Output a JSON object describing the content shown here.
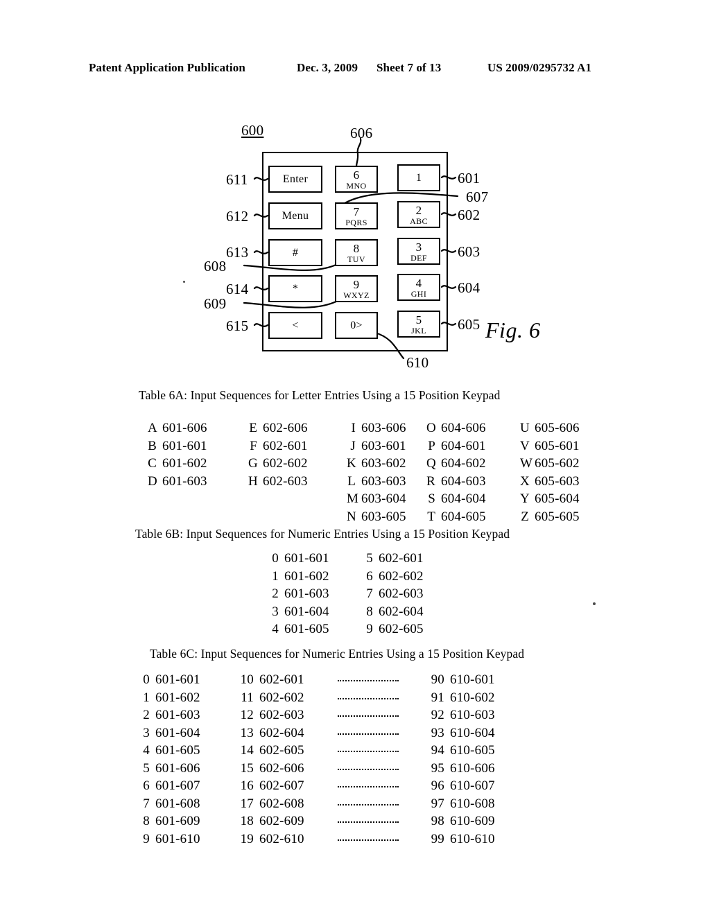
{
  "header": {
    "publication": "Patent Application Publication",
    "date": "Dec. 3, 2009",
    "sheet": "Sheet 7 of 13",
    "patent_number": "US 2009/0295732 A1"
  },
  "figure": {
    "caption": "Fig. 6",
    "device_ref": "600",
    "callouts": {
      "c600": "600",
      "c606": "606",
      "c607": "607",
      "c608": "608",
      "c609": "609",
      "c610": "610",
      "c601": "601",
      "c602": "602",
      "c603": "603",
      "c604": "604",
      "c605": "605",
      "c611": "611",
      "c612": "612",
      "c613": "613",
      "c614": "614",
      "c615": "615"
    },
    "keys": [
      {
        "id": "enter",
        "main": "Enter",
        "sub": "",
        "ref": "611"
      },
      {
        "id": "menu",
        "main": "Menu",
        "sub": "",
        "ref": "612"
      },
      {
        "id": "hash",
        "main": "#",
        "sub": "",
        "ref": "613"
      },
      {
        "id": "star",
        "main": "*",
        "sub": "",
        "ref": "614"
      },
      {
        "id": "left",
        "main": "<",
        "sub": "",
        "ref": "615"
      },
      {
        "id": "key6",
        "main": "6",
        "sub": "MNO",
        "ref": "606"
      },
      {
        "id": "key7",
        "main": "7",
        "sub": "PQRS",
        "ref": "607"
      },
      {
        "id": "key8",
        "main": "8",
        "sub": "TUV",
        "ref": "608"
      },
      {
        "id": "key9",
        "main": "9",
        "sub": "WXYZ",
        "ref": "609"
      },
      {
        "id": "key0",
        "main": "0>",
        "sub": "",
        "ref": "610"
      },
      {
        "id": "key1",
        "main": "1",
        "sub": "",
        "ref": "601"
      },
      {
        "id": "key2",
        "main": "2",
        "sub": "ABC",
        "ref": "602"
      },
      {
        "id": "key3",
        "main": "3",
        "sub": "DEF",
        "ref": "603"
      },
      {
        "id": "key4",
        "main": "4",
        "sub": "GHI",
        "ref": "604"
      },
      {
        "id": "key5",
        "main": "5",
        "sub": "JKL",
        "ref": "605"
      }
    ]
  },
  "table_6a": {
    "title": "Table 6A: Input Sequences for Letter Entries Using a 15 Position Keypad",
    "columns": [
      {
        "rows": [
          {
            "label": "A",
            "seq": "601-606"
          },
          {
            "label": "B",
            "seq": "601-601"
          },
          {
            "label": "C",
            "seq": "601-602"
          },
          {
            "label": "D",
            "seq": "601-603"
          }
        ]
      },
      {
        "rows": [
          {
            "label": "E",
            "seq": "602-606"
          },
          {
            "label": "F",
            "seq": "602-601"
          },
          {
            "label": "G",
            "seq": "602-602"
          },
          {
            "label": "H",
            "seq": "602-603"
          }
        ]
      },
      {
        "rows": [
          {
            "label": "I",
            "seq": "603-606"
          },
          {
            "label": "J",
            "seq": "603-601"
          },
          {
            "label": "K",
            "seq": "603-602"
          },
          {
            "label": "L",
            "seq": "603-603"
          },
          {
            "label": "M",
            "seq": "603-604"
          },
          {
            "label": "N",
            "seq": "603-605"
          }
        ]
      },
      {
        "rows": [
          {
            "label": "O",
            "seq": "604-606"
          },
          {
            "label": "P",
            "seq": "604-601"
          },
          {
            "label": "Q",
            "seq": "604-602"
          },
          {
            "label": "R",
            "seq": "604-603"
          },
          {
            "label": "S",
            "seq": "604-604"
          },
          {
            "label": "T",
            "seq": "604-605"
          }
        ]
      },
      {
        "rows": [
          {
            "label": "U",
            "seq": "605-606"
          },
          {
            "label": "V",
            "seq": "605-601"
          },
          {
            "label": "W",
            "seq": "605-602"
          },
          {
            "label": "X",
            "seq": "605-603"
          },
          {
            "label": "Y",
            "seq": "605-604"
          },
          {
            "label": "Z",
            "seq": "605-605"
          }
        ]
      }
    ]
  },
  "table_6b": {
    "title": "Table 6B: Input Sequences for Numeric Entries Using a 15 Position Keypad",
    "columns": [
      {
        "rows": [
          {
            "label": "0",
            "seq": "601-601"
          },
          {
            "label": "1",
            "seq": "601-602"
          },
          {
            "label": "2",
            "seq": "601-603"
          },
          {
            "label": "3",
            "seq": "601-604"
          },
          {
            "label": "4",
            "seq": "601-605"
          }
        ]
      },
      {
        "rows": [
          {
            "label": "5",
            "seq": "602-601"
          },
          {
            "label": "6",
            "seq": "602-602"
          },
          {
            "label": "7",
            "seq": "602-603"
          },
          {
            "label": "8",
            "seq": "602-604"
          },
          {
            "label": "9",
            "seq": "602-605"
          }
        ]
      }
    ]
  },
  "table_6c": {
    "title": "Table 6C: Input Sequences for Numeric Entries Using a 15 Position Keypad",
    "ellipsis_rows": 10,
    "columns": [
      {
        "rows": [
          {
            "label": "0",
            "seq": "601-601"
          },
          {
            "label": "1",
            "seq": "601-602"
          },
          {
            "label": "2",
            "seq": "601-603"
          },
          {
            "label": "3",
            "seq": "601-604"
          },
          {
            "label": "4",
            "seq": "601-605"
          },
          {
            "label": "5",
            "seq": "601-606"
          },
          {
            "label": "6",
            "seq": "601-607"
          },
          {
            "label": "7",
            "seq": "601-608"
          },
          {
            "label": "8",
            "seq": "601-609"
          },
          {
            "label": "9",
            "seq": "601-610"
          }
        ]
      },
      {
        "rows": [
          {
            "label": "10",
            "seq": "602-601"
          },
          {
            "label": "11",
            "seq": "602-602"
          },
          {
            "label": "12",
            "seq": "602-603"
          },
          {
            "label": "13",
            "seq": "602-604"
          },
          {
            "label": "14",
            "seq": "602-605"
          },
          {
            "label": "15",
            "seq": "602-606"
          },
          {
            "label": "16",
            "seq": "602-607"
          },
          {
            "label": "17",
            "seq": "602-608"
          },
          {
            "label": "18",
            "seq": "602-609"
          },
          {
            "label": "19",
            "seq": "602-610"
          }
        ]
      },
      {
        "rows": [
          {
            "label": "90",
            "seq": "610-601"
          },
          {
            "label": "91",
            "seq": "610-602"
          },
          {
            "label": "92",
            "seq": "610-603"
          },
          {
            "label": "93",
            "seq": "610-604"
          },
          {
            "label": "94",
            "seq": "610-605"
          },
          {
            "label": "95",
            "seq": "610-606"
          },
          {
            "label": "96",
            "seq": "610-607"
          },
          {
            "label": "97",
            "seq": "610-608"
          },
          {
            "label": "98",
            "seq": "610-609"
          },
          {
            "label": "99",
            "seq": "610-610"
          }
        ]
      }
    ]
  }
}
